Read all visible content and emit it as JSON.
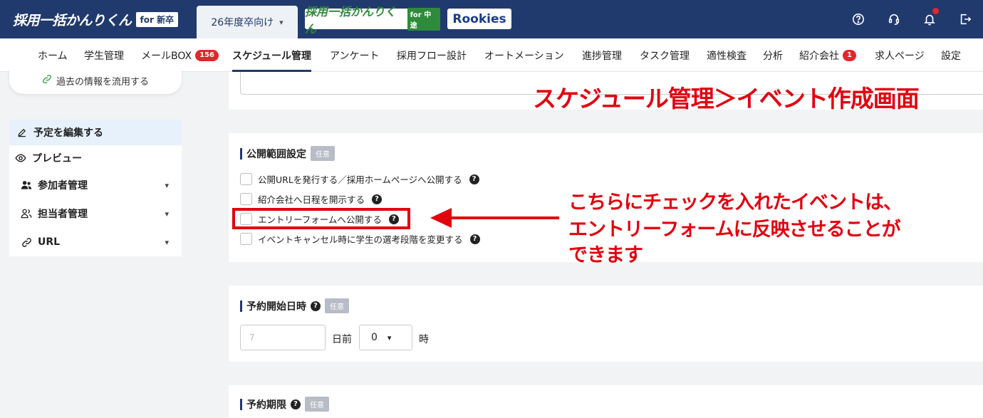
{
  "header": {
    "logo_main": "採用一括かんりくん",
    "logo_main_tag": "for 新卒",
    "year_select": "26年度卒向け",
    "logo_mid": "採用一括かんりくん",
    "logo_mid_tag": "for 中途",
    "logo_rookies": "Rookies",
    "icons": [
      "help-icon",
      "support-headset-icon",
      "bell-icon",
      "logout-icon"
    ]
  },
  "nav": {
    "items": [
      {
        "label": "ホーム"
      },
      {
        "label": "学生管理"
      },
      {
        "label": "メールBOX",
        "badge": "156"
      },
      {
        "label": "スケジュール管理",
        "active": true
      },
      {
        "label": "アンケート"
      },
      {
        "label": "採用フロー設計"
      },
      {
        "label": "オートメーション"
      },
      {
        "label": "進捗管理"
      },
      {
        "label": "タスク管理"
      },
      {
        "label": "適性検査"
      },
      {
        "label": "分析"
      },
      {
        "label": "紹介会社",
        "badge": "1"
      },
      {
        "label": "求人ページ"
      },
      {
        "label": "設定"
      }
    ]
  },
  "sidebar": {
    "reuse_button": "過去の情報を流用する",
    "items": [
      {
        "label": "予定を編集する",
        "icon": "pencil-icon"
      },
      {
        "label": "プレビュー",
        "icon": "eye-icon"
      },
      {
        "label": "参加者管理",
        "icon": "users-icon"
      },
      {
        "label": "担当者管理",
        "icon": "user-group-icon"
      },
      {
        "label": "URL",
        "icon": "link-icon"
      }
    ]
  },
  "publish_section": {
    "title": "公開範囲設定",
    "badge": "任意",
    "options": [
      {
        "label": "公開URLを発行する／採用ホームページへ公開する",
        "checked": false
      },
      {
        "label": "紹介会社へ日程を開示する",
        "checked": false
      },
      {
        "label": "エントリーフォームへ公開する",
        "checked": false
      },
      {
        "label": "イベントキャンセル時に学生の選考段階を変更する",
        "checked": false
      }
    ]
  },
  "booking_start": {
    "title": "予約開始日時",
    "badge": "任意",
    "days_placeholder": "7",
    "days_unit": "日前",
    "hour_value": "0",
    "hour_unit": "時"
  },
  "booking_deadline": {
    "title": "予約期限",
    "badge": "任意"
  },
  "annotations": {
    "title": "スケジュール管理＞イベント作成画面",
    "line1": "こちらにチェックを入れたイベントは、",
    "line2": "エントリーフォームに反映させることが",
    "line3": "できます",
    "accent": "#e2000f"
  }
}
